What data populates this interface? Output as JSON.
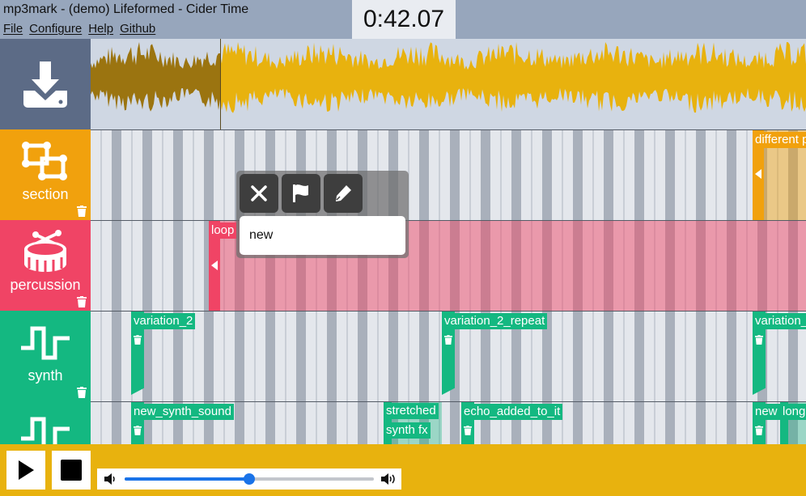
{
  "window": {
    "title": "mp3mark - (demo) Lifeformed - Cider Time"
  },
  "menu": [
    "File",
    "Configure",
    "Help",
    "Github"
  ],
  "timer": "0:42.07",
  "tracks": [
    {
      "name": "section",
      "color": "#f1a10d",
      "icon": "section-icon"
    },
    {
      "name": "percussion",
      "color": "#f04465",
      "icon": "drum-icon"
    },
    {
      "name": "synth",
      "color": "#14b881",
      "icon": "square-wave-icon"
    },
    {
      "name": "",
      "color": "#14b881",
      "icon": "square-wave-icon"
    }
  ],
  "clips": {
    "section": [
      {
        "label": "different p"
      }
    ],
    "percussion": [
      {
        "label": "loop"
      }
    ],
    "synth": [
      {
        "label": "variation_2"
      },
      {
        "label": "variation_2_repeat"
      },
      {
        "label": "variation_"
      }
    ],
    "synth2": [
      {
        "label": "new_synth_sound"
      },
      {
        "label": "stretched"
      },
      {
        "label": "synth fx"
      },
      {
        "label": "echo_added_to_it"
      },
      {
        "label": "new"
      },
      {
        "label": "long"
      }
    ]
  },
  "popup": {
    "input_value": "new",
    "buttons": [
      "close-icon",
      "flag-icon",
      "pen-icon"
    ]
  },
  "playback": {
    "volume": 0.5
  },
  "colors": {
    "waveform_played": "#9b7410",
    "waveform_unplayed": "#e8b20e",
    "playhead": "#5a4a20"
  }
}
